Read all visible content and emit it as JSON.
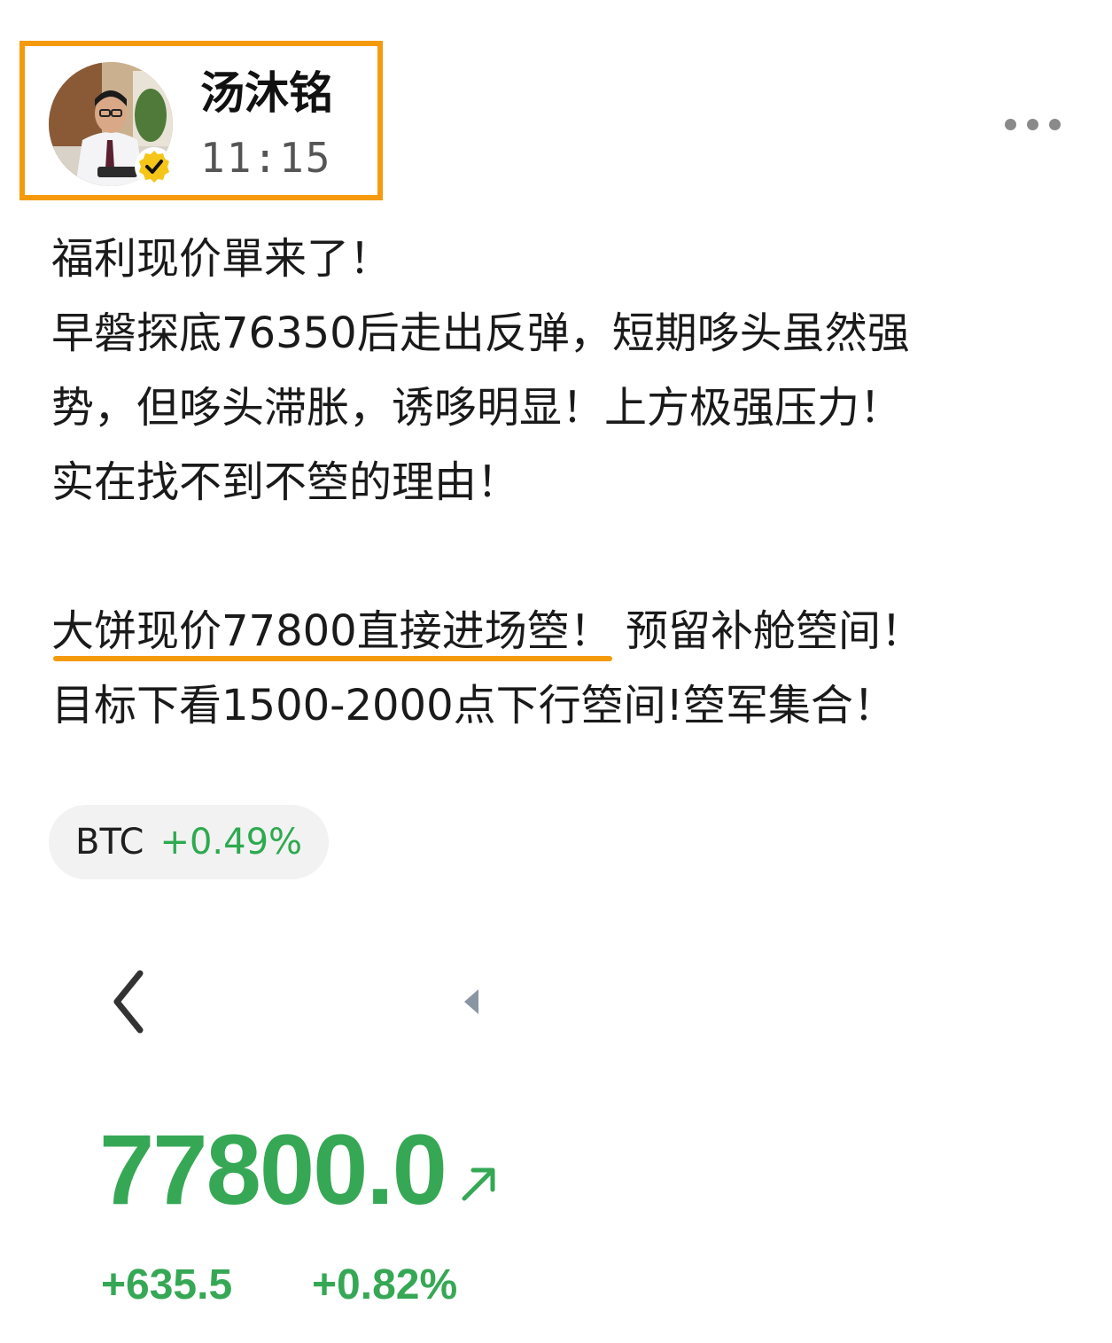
{
  "post": {
    "author": {
      "name": "汤沐铭",
      "time": "11:15",
      "verified": true
    },
    "more_icon": "more-horizontal-icon",
    "body_lines": [
      "福利现价單来了！",
      "早磐探底76350后走出反弹，短期哆头虽然强",
      "势，但哆头滞胀，诱哆明显！上方极强压力！",
      "实在找不到不箜的理由！",
      "",
      "大饼现价77800直接进场箜！",
      "预留补舱箜间！",
      "目标下看1500-2000点下行箜间!箜军集合！"
    ],
    "ticker": {
      "symbol": "BTC",
      "change": "+0.49%"
    },
    "quote_card": {
      "price": "77800.0",
      "change": "+635.5",
      "change_pct": "+0.82%"
    }
  },
  "colors": {
    "highlight": "#f59a0c",
    "positive": "#36a855",
    "chip_bg": "#f2f2f2"
  }
}
